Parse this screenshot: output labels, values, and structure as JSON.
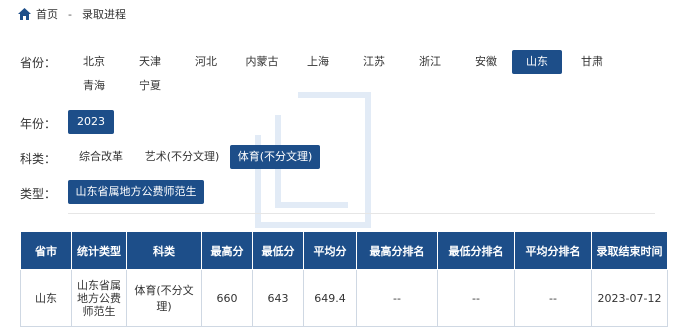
{
  "breadcrumb": {
    "home": "首页",
    "separator": "-",
    "current": "录取进程"
  },
  "filters": {
    "province": {
      "label": "省份：",
      "options": [
        "北京",
        "天津",
        "河北",
        "内蒙古",
        "上海",
        "江苏",
        "浙江",
        "安徽",
        "山东",
        "甘肃",
        "青海",
        "宁夏"
      ],
      "selected": "山东"
    },
    "year": {
      "label": "年份：",
      "options": [
        "2023"
      ],
      "selected": "2023"
    },
    "subject": {
      "label": "科类：",
      "options": [
        "综合改革",
        "艺术(不分文理)",
        "体育(不分文理)"
      ],
      "selected": "体育(不分文理)"
    },
    "type": {
      "label": "类型：",
      "options": [
        "山东省属地方公费师范生"
      ],
      "selected": "山东省属地方公费师范生"
    }
  },
  "table": {
    "headers": [
      "省市",
      "统计类型",
      "科类",
      "最高分",
      "最低分",
      "平均分",
      "最高分排名",
      "最低分排名",
      "平均分排名",
      "录取结束时间"
    ],
    "rows": [
      [
        "山东",
        "山东省属地方公费师范生",
        "体育(不分文理)",
        "660",
        "643",
        "649.4",
        "--",
        "--",
        "--",
        "2023-07-12"
      ]
    ]
  },
  "colors": {
    "accent": "#1d4e89",
    "table_border": "#cfd8e3"
  }
}
